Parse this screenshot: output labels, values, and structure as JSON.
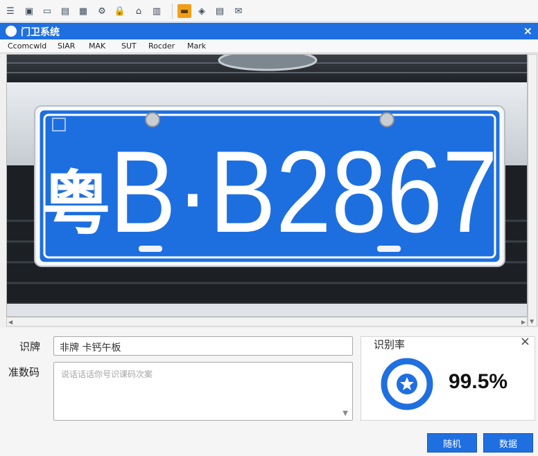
{
  "toolbar": {
    "buttons": [
      {
        "name": "list-icon"
      },
      {
        "name": "id-card-icon"
      },
      {
        "name": "monitor-icon"
      },
      {
        "name": "document-icon"
      },
      {
        "name": "table-icon"
      },
      {
        "name": "bicycle-icon"
      },
      {
        "name": "lock-icon"
      },
      {
        "name": "home-icon"
      },
      {
        "name": "archive-icon"
      },
      {
        "name": "highlight-icon"
      },
      {
        "name": "diamond-icon"
      },
      {
        "name": "clipboard-icon"
      },
      {
        "name": "mail-icon"
      }
    ],
    "active_color": "#f0a018"
  },
  "window": {
    "title": "门卫系统",
    "close": "×"
  },
  "menu": {
    "items": [
      "Ccomcwld",
      "SIAR",
      "MAK",
      "SUT",
      "Rocder",
      "Mark"
    ]
  },
  "plate": {
    "province": "粤",
    "text": "B·B2867",
    "bg_color": "#1d6fe0"
  },
  "form": {
    "plate_label": "识牌",
    "plate_value": "非牌 卡钙午板",
    "code_label": "准数码",
    "code_placeholder": "说话话话你号识课码次案"
  },
  "recognition": {
    "title": "识别率",
    "rate": "99.5%",
    "close": "×"
  },
  "actions": {
    "btn1": "随机",
    "btn2": "数据"
  }
}
